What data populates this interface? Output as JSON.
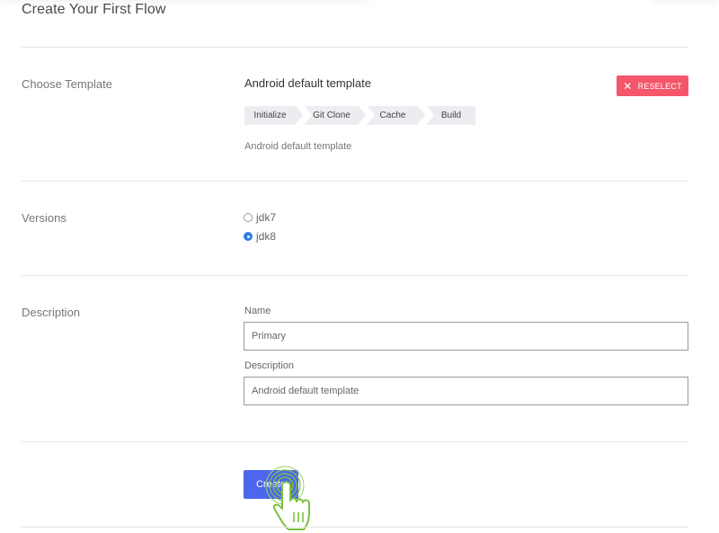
{
  "page": {
    "title": "Create Your First Flow"
  },
  "choose_template": {
    "label": "Choose Template",
    "template_name": "Android default template",
    "reselect_label": "RESELECT",
    "steps": [
      "Initialize",
      "Git Clone",
      "Cache",
      "Build"
    ],
    "description": "Android default template"
  },
  "versions": {
    "label": "Versions",
    "options": [
      {
        "label": "jdk7",
        "selected": false
      },
      {
        "label": "jdk8",
        "selected": true
      }
    ]
  },
  "description_section": {
    "label": "Description",
    "name_label": "Name",
    "name_value": "Primary",
    "description_label": "Description",
    "description_value": "Android default template"
  },
  "actions": {
    "create_label": "Create"
  },
  "colors": {
    "accent": "#4d66ee",
    "danger": "#f4566a",
    "radio_selected": "#2f7fe0",
    "cursor_green": "#7ac142"
  }
}
